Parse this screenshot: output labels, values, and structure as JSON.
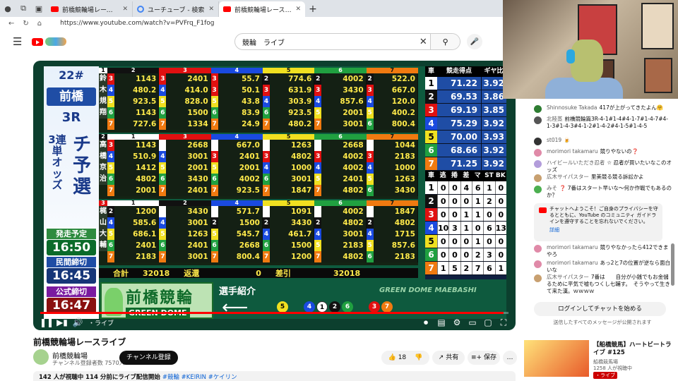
{
  "browser": {
    "tabs": [
      {
        "title": "前橋競輪場レースライブ - YouTube",
        "icon": "youtube-icon"
      },
      {
        "title": "ユーチューブ - 検索",
        "icon": "google-icon"
      },
      {
        "title": "前橋競輪場レースライブ - YouTu",
        "icon": "youtube-icon",
        "active": true
      }
    ],
    "new_tab": "+",
    "url": "https://www.youtube.com/watch?v=PVFrq_F1fog"
  },
  "youtube": {
    "search_value": "競輪　ライブ",
    "clear": "✕",
    "search_icon": "⚲",
    "mic_icon": "🎤"
  },
  "board": {
    "race_no": "22#",
    "venue": "前橋",
    "race": "3R",
    "bet_type": "3連単オッズ",
    "race_class": "チ予選",
    "times": [
      {
        "label": "発走予定",
        "value": "16:50"
      },
      {
        "label": "民間締切",
        "value": "16:45"
      },
      {
        "label": "公式締切",
        "value": "16:47"
      }
    ],
    "col_headers": [
      "1",
      "2",
      "3",
      "4",
      "5",
      "6",
      "7"
    ],
    "sections": [
      {
        "first": "1",
        "riders": [
          "鈴",
          "木",
          "規",
          "翔"
        ],
        "rows": [
          [
            [
              "3",
              "1143"
            ],
            [
              "3",
              "2401"
            ],
            [
              "3",
              "55.7"
            ],
            [
              "2",
              "774.6"
            ],
            [
              "2",
              "4002"
            ],
            [
              "2",
              "522.0"
            ]
          ],
          [
            [
              "4",
              "480.2"
            ],
            [
              "4",
              "414.0"
            ],
            [
              "3",
              "50.1"
            ],
            [
              "3",
              "631.9"
            ],
            [
              "3",
              "3430"
            ],
            [
              "3",
              "667.0"
            ]
          ],
          [
            [
              "5",
              "923.5"
            ],
            [
              "5",
              "828.0"
            ],
            [
              "5",
              "43.8"
            ],
            [
              "4",
              "303.9"
            ],
            [
              "4",
              "857.6"
            ],
            [
              "4",
              "120.0"
            ]
          ],
          [
            [
              "6",
              "1143"
            ],
            [
              "6",
              "1500"
            ],
            [
              "6",
              "83.9"
            ],
            [
              "6",
              "923.5"
            ],
            [
              "5",
              "2001"
            ],
            [
              "5",
              "400.2"
            ]
          ],
          [
            [
              "7",
              "727.6"
            ],
            [
              "7",
              "1334"
            ],
            [
              "7",
              "24.9"
            ],
            [
              "7",
              "480.2"
            ],
            [
              "7",
              "3001"
            ],
            [
              "6",
              "800.4"
            ]
          ]
        ]
      },
      {
        "first": "2",
        "riders": [
          "高",
          "橋",
          "京",
          "治"
        ],
        "rows": [
          [
            [
              "3",
              "1143"
            ],
            [
              "1",
              "2668"
            ],
            [
              "1",
              "667.0"
            ],
            [
              "1",
              "1263"
            ],
            [
              "1",
              "2668"
            ],
            [
              "1",
              "1044"
            ]
          ],
          [
            [
              "4",
              "510.9"
            ],
            [
              "4",
              "3001"
            ],
            [
              "3",
              "2401"
            ],
            [
              "3",
              "4802"
            ],
            [
              "3",
              "4002"
            ],
            [
              "3",
              "2183"
            ]
          ],
          [
            [
              "5",
              "1412"
            ],
            [
              "5",
              "2001"
            ],
            [
              "5",
              "2001"
            ],
            [
              "4",
              "1000"
            ],
            [
              "4",
              "4002"
            ],
            [
              "4",
              "1000"
            ]
          ],
          [
            [
              "6",
              "4802"
            ],
            [
              "6",
              "3430"
            ],
            [
              "6",
              "4002"
            ],
            [
              "6",
              "3001"
            ],
            [
              "5",
              "2401"
            ],
            [
              "5",
              "1263"
            ]
          ],
          [
            [
              "7",
              "2001"
            ],
            [
              "7",
              "2401"
            ],
            [
              "7",
              "923.5"
            ],
            [
              "7",
              "1847"
            ],
            [
              "7",
              "4802"
            ],
            [
              "6",
              "3430"
            ]
          ]
        ]
      },
      {
        "first": "3",
        "riders": [
          "梶",
          "山",
          "大",
          "輔"
        ],
        "rows": [
          [
            [
              "2",
              "1200"
            ],
            [
              "1",
              "3430"
            ],
            [
              "1",
              "571.7"
            ],
            [
              "1",
              "1091"
            ],
            [
              "1",
              "4002"
            ],
            [
              "1",
              "1847"
            ]
          ],
          [
            [
              "4",
              "585.6"
            ],
            [
              "4",
              "3001"
            ],
            [
              "2",
              "1500"
            ],
            [
              "2",
              "3430"
            ],
            [
              "2",
              "4802"
            ],
            [
              "2",
              "4802"
            ]
          ],
          [
            [
              "5",
              "686.1"
            ],
            [
              "5",
              "1263"
            ],
            [
              "5",
              "545.7"
            ],
            [
              "4",
              "461.7"
            ],
            [
              "4",
              "3001"
            ],
            [
              "4",
              "1715"
            ]
          ],
          [
            [
              "6",
              "2401"
            ],
            [
              "6",
              "2401"
            ],
            [
              "6",
              "2668"
            ],
            [
              "6",
              "1500"
            ],
            [
              "5",
              "2183"
            ],
            [
              "5",
              "857.6"
            ]
          ],
          [
            [
              "7",
              "2183"
            ],
            [
              "7",
              "3001"
            ],
            [
              "7",
              "800.4"
            ],
            [
              "7",
              "1200"
            ],
            [
              "7",
              "4802"
            ],
            [
              "6",
              "2183"
            ]
          ]
        ]
      }
    ],
    "totals": {
      "label1": "合計",
      "v1": "32018",
      "label2": "返還",
      "v2": "0",
      "label3": "差引",
      "v3": "32018"
    },
    "score_header": [
      "車",
      "競走得点",
      "ギヤ比"
    ],
    "scores": [
      [
        "1",
        "71.22",
        "3.92"
      ],
      [
        "2",
        "69.53",
        "3.86"
      ],
      [
        "3",
        "69.19",
        "3.85"
      ],
      [
        "4",
        "75.29",
        "3.92"
      ],
      [
        "5",
        "70.00",
        "3.93"
      ],
      [
        "6",
        "68.66",
        "3.92"
      ],
      [
        "7",
        "71.25",
        "3.92"
      ]
    ],
    "stats_header": [
      "車",
      "逃",
      "捲",
      "差",
      "マ",
      "ST",
      "BK"
    ],
    "stats": [
      [
        "1",
        "0",
        "0",
        "4",
        "6",
        "1",
        "0"
      ],
      [
        "2",
        "0",
        "0",
        "0",
        "1",
        "2",
        "0"
      ],
      [
        "3",
        "0",
        "0",
        "1",
        "1",
        "0",
        "0"
      ],
      [
        "4",
        "10",
        "3",
        "1",
        "0",
        "6",
        "13"
      ],
      [
        "5",
        "0",
        "0",
        "0",
        "1",
        "0",
        "0"
      ],
      [
        "6",
        "0",
        "0",
        "0",
        "2",
        "3",
        "0"
      ],
      [
        "7",
        "1",
        "5",
        "2",
        "7",
        "6",
        "1"
      ]
    ],
    "banner_main": "前橋競輪",
    "banner_sub": "GREEN DOME",
    "intro": "選手紹介",
    "arrow": "⟵",
    "lineup": [
      "5",
      "4",
      "1",
      "2",
      "6",
      "3",
      "7"
    ],
    "watermark": "GREEN DOME MAEBASHI"
  },
  "player": {
    "progress": 0.99,
    "play": "❚❚",
    "next": "▶▮",
    "vol": "🔊",
    "live": "・ライブ",
    "icons": [
      "⏺",
      "▤",
      "⚙",
      "▭",
      "▢",
      "⛶"
    ]
  },
  "video": {
    "title": "前橋競輪場レースライブ",
    "channel": "前橋競輪場",
    "subs": "チャンネル登録者数 7570人",
    "subscribe": "チャンネル登録",
    "likes": "18",
    "share": "共有",
    "save": "保存",
    "more": "…",
    "meta": "142 人が視聴中  114 分前にライブ配信開始",
    "tags": "#競輪 #KEIRIN #ケイリン"
  },
  "chat": {
    "messages": [
      {
        "author": "Shinnosuke Takada",
        "text": "417が上がってきたよん🤗",
        "color": "#2e7d32"
      },
      {
        "author": "北陸蒸",
        "text": "前橋競輪篇3R-4-1#1-4#4-1-7#1-4-7#4-1-3#1-4-3#4-1-2#1-4-2#4-1-5#1-4-5",
        "color": "#555"
      },
      {
        "author": "st019",
        "text": "🍺",
        "color": "#333"
      },
      {
        "author": "morimori takamaru",
        "text": "競りやないの❓",
        "color": "#e08aa8"
      },
      {
        "author": "ハイビールいただき忍者",
        "text": "☆ 忍者が買いたいなこのオッズ",
        "color": "#b39ddb"
      },
      {
        "author": "広木サイパスター",
        "text": "里美競る競る訴訟かよ",
        "color": "#c8a070"
      },
      {
        "author": "みそ",
        "text": "❓ 7番はスタート早いな〜何か作戦でもあるのか？",
        "color": "#4caf50"
      }
    ],
    "notice": "チャットへようこそ！ご自身のプライバシーを守るとともに、YouTube のコミュニティ ガイドラインを遵守することを忘れないでください。",
    "notice_more": "詳細",
    "messages2": [
      {
        "author": "morimori takamaru",
        "text": "競りやなかったら412できまやろ",
        "color": "#e08aa8"
      },
      {
        "author": "morimori takamaru",
        "text": "あっ2と7の位置が逆なら面白いな",
        "color": "#e08aa8"
      },
      {
        "author": "広木サイパスター",
        "text": "7番は　　自分が小銭でもお金儲るために平気で嘘もつくし七輔す。　そうやって生きて来た漢。ｗｗｗｗ",
        "color": "#c8a070"
      }
    ],
    "login": "ログインしてチャットを始める",
    "footer": "送信したすべてのメッセージが公開されます"
  },
  "reco": {
    "title": "【船橋競馬】ハートビートライブ #125",
    "channel": "船橋競馬場",
    "viewers": "1258 人が視聴中",
    "live": "・ライブ"
  }
}
